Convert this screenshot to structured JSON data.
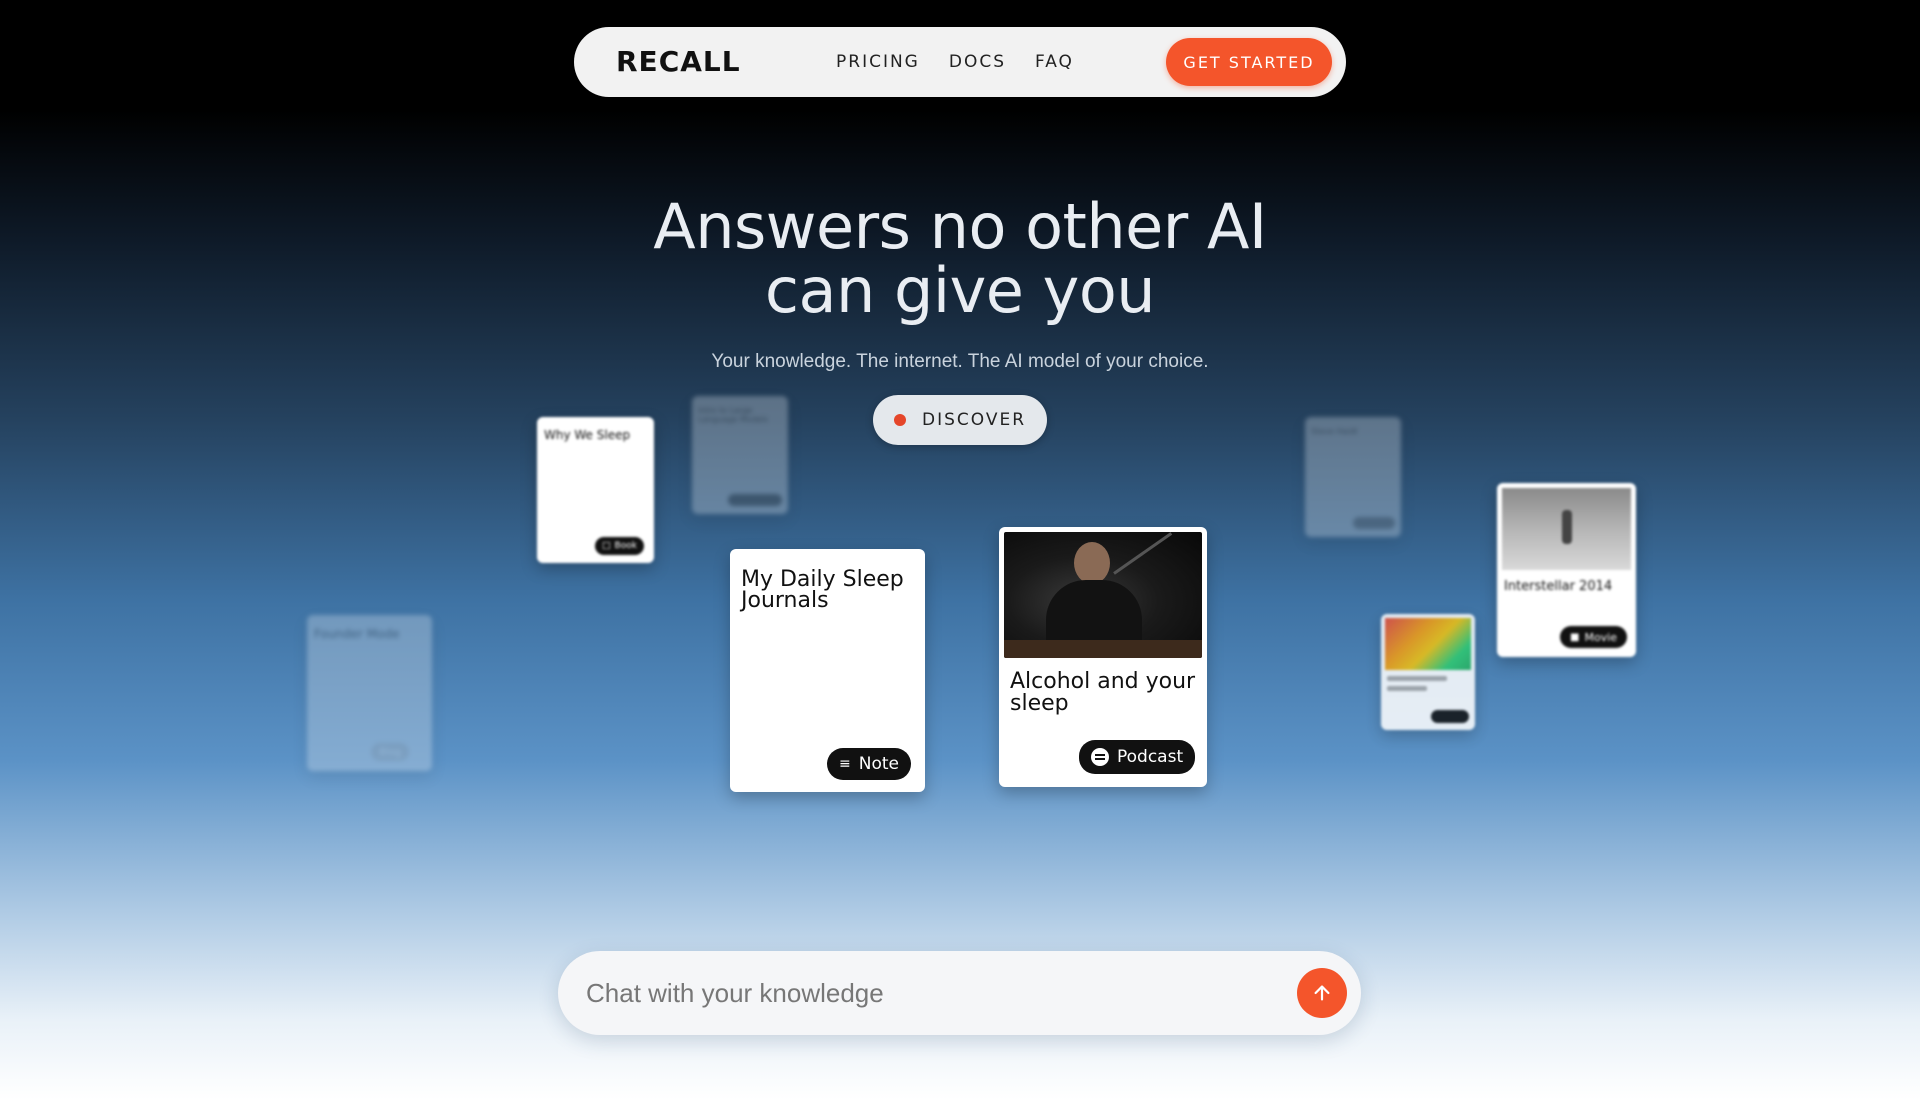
{
  "nav": {
    "logo": "RECALL",
    "links": [
      "PRICING",
      "DOCS",
      "FAQ"
    ],
    "cta": "GET STARTED"
  },
  "hero": {
    "title_line1": "Answers no other AI",
    "title_line2": "can give you",
    "subtitle": "Your knowledge. The internet. The AI model of your choice.",
    "discover": "DISCOVER"
  },
  "cards": {
    "why_we_sleep": {
      "title": "Why We Sleep",
      "tag": "Book"
    },
    "llm_intro": {
      "title": "Intro to Large Language Models",
      "tag": ""
    },
    "sleep_journals": {
      "title": "My Daily Sleep Journals",
      "tag": "Note"
    },
    "alcohol_sleep": {
      "title": "Alcohol and your sleep",
      "tag": "Podcast"
    },
    "founder_mode": {
      "title": "Founder Mode",
      "tag": "Blog"
    },
    "steve_haidt": {
      "title": "Steve Haidt",
      "tag": ""
    },
    "interstellar": {
      "title": "Interstellar 2014",
      "tag": "Movie"
    },
    "colorful": {
      "title": "",
      "tag": ""
    }
  },
  "chat": {
    "placeholder": "Chat with your knowledge"
  },
  "colors": {
    "accent": "#f4552b",
    "discover_dot": "#e5462a"
  }
}
